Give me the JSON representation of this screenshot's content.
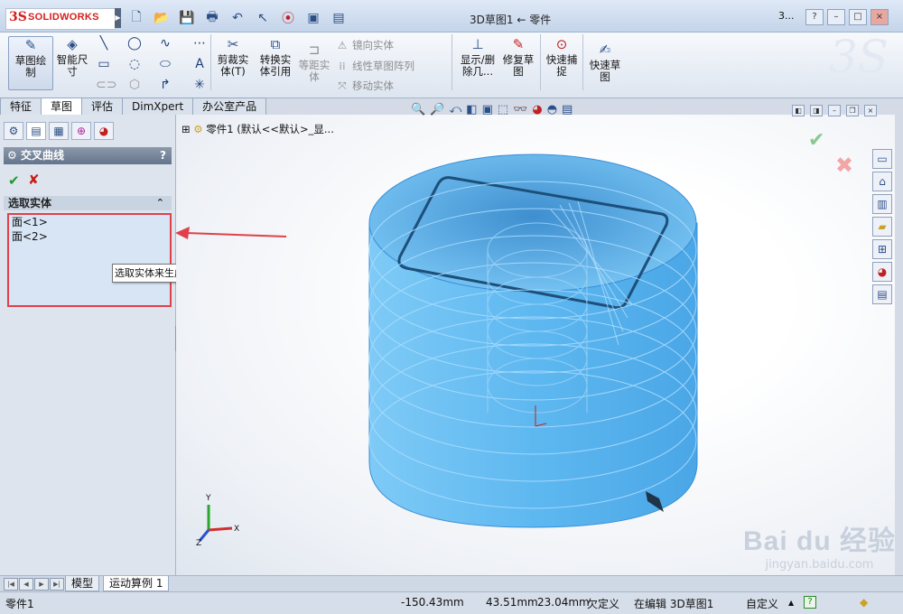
{
  "app": {
    "logo": {
      "ds": "3S",
      "name": "SOLIDWORKS"
    },
    "title": "3D草图1 ← 零件",
    "window_controls": [
      "3...",
      "?",
      "–",
      "□",
      "×"
    ]
  },
  "quick_access": {
    "icons": [
      "new-file-icon",
      "open-folder-icon",
      "save-icon",
      "print-icon",
      "undo-icon",
      "select-arrow-icon",
      "traffic-light-icon",
      "options-icon",
      "customize-icon"
    ]
  },
  "ribbon": {
    "sketch_label": "草图绘\n制",
    "smart_dim_label": "智能尺\n寸",
    "trim_label": "剪裁实\n体(T)",
    "convert_label": "转换实\n体引用",
    "offset_label": "等距实\n体",
    "mirror_label": "镜向实体",
    "linear_pattern_label": "线性草图阵列",
    "move_label": "移动实体",
    "show_delete_label": "显示/删\n除几...",
    "repair_label": "修复草\n图",
    "quick_snap_label": "快速捕\n捉",
    "quick_sketch_label": "快速草\n图"
  },
  "tabs": [
    {
      "label": "特征",
      "active": false
    },
    {
      "label": "草图",
      "active": true
    },
    {
      "label": "评估",
      "active": false
    },
    {
      "label": "DimXpert",
      "active": false
    },
    {
      "label": "办公室产品",
      "active": false
    }
  ],
  "property_manager": {
    "title": "交叉曲线",
    "help": "?",
    "section_title": "选取实体",
    "selections": [
      "面<1>",
      "面<2>"
    ],
    "tooltip": "选取实体来生成交叉曲线"
  },
  "viewport": {
    "tree_root": "零件1  (默认<<默认>_显...",
    "triad_labels": {
      "x": "X",
      "y": "Y",
      "z": "Z"
    }
  },
  "bottom_tabs": [
    "模型",
    "运动算例 1"
  ],
  "status_bar": {
    "part_name": "零件1",
    "x_coord": "-150.43mm",
    "y_coord": "43.51mm",
    "z_coord": "23.04mm",
    "definition": "欠定义",
    "editing": "在编辑 3D草图1",
    "units": "自定义",
    "help": "?"
  },
  "watermark": {
    "brand": "Bai du 经验",
    "url": "jingyan.baidu.com"
  },
  "colors": {
    "part_blue": "#64bdf2",
    "highlight_red": "#e0404a",
    "accent": "#d51e1e"
  }
}
